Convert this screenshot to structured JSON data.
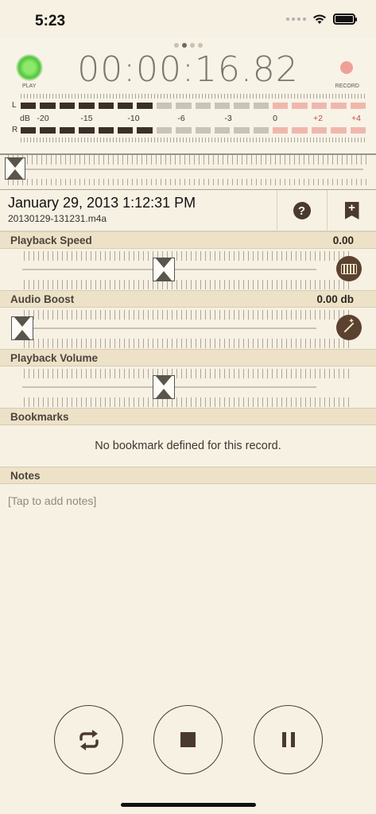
{
  "status_bar": {
    "time": "5:23"
  },
  "header": {
    "timer": "00:00:16.82",
    "play_label": "PLAY",
    "record_label": "RECORD",
    "meter_left_label": "L",
    "meter_right_label": "R",
    "db_label": "dB",
    "scale": [
      "-20",
      "-15",
      "-10",
      "-6",
      "-3",
      "0",
      "+2",
      "+4"
    ],
    "colors": {
      "play_led": "#4fc43b",
      "record_led": "#f0a09a",
      "meter_dark": "#3b2f26",
      "meter_gray": "#c9c3b8",
      "meter_red": "#f0b8ad"
    }
  },
  "record": {
    "date": "January 29, 2013 1:12:31 PM",
    "filename": "20130129-131231.m4a",
    "help_icon": "help-icon",
    "bookmark_icon": "bookmark-add-icon"
  },
  "sections": {
    "playback_speed": {
      "title": "Playback Speed",
      "value": "0.00"
    },
    "audio_boost": {
      "title": "Audio Boost",
      "value": "0.00 db"
    },
    "playback_volume": {
      "title": "Playback Volume"
    },
    "bookmarks": {
      "title": "Bookmarks",
      "empty_text": "No bookmark defined for this record."
    },
    "notes": {
      "title": "Notes",
      "placeholder": "[Tap to add notes]"
    }
  },
  "controls": {
    "repeat_icon": "repeat-icon",
    "stop_icon": "stop-icon",
    "pause_icon": "pause-icon"
  },
  "sliders": {
    "playback_position": 0.0,
    "playback_speed": 0.5,
    "audio_boost": 0.0,
    "playback_volume": 0.5
  }
}
